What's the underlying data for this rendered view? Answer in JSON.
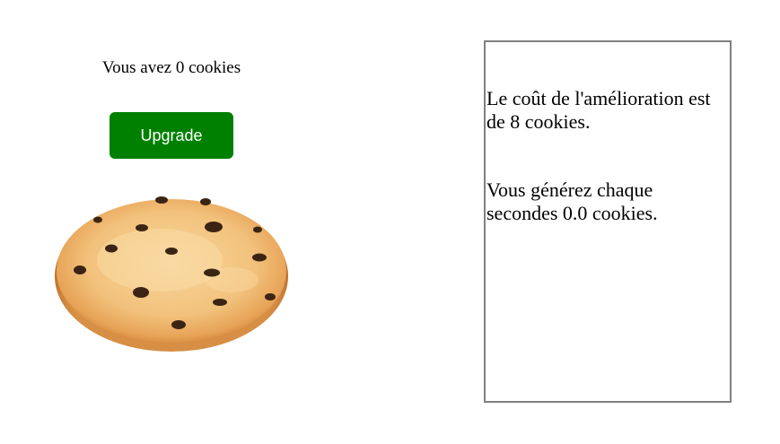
{
  "left": {
    "cookie_count_text": "Vous avez 0 cookies",
    "upgrade_button_label": "Upgrade",
    "cookie_icon": "chocolate-chip-cookie"
  },
  "info": {
    "upgrade_cost_text": "Le coût de l'amélioration est de 8 cookies.",
    "generation_rate_text": "Vous générez chaque secondes 0.0 cookies."
  },
  "colors": {
    "button_bg": "#008000",
    "button_text": "#ffffff",
    "panel_border": "#808080",
    "cookie_dough": "#f3c07a",
    "cookie_chip": "#3b2414"
  }
}
